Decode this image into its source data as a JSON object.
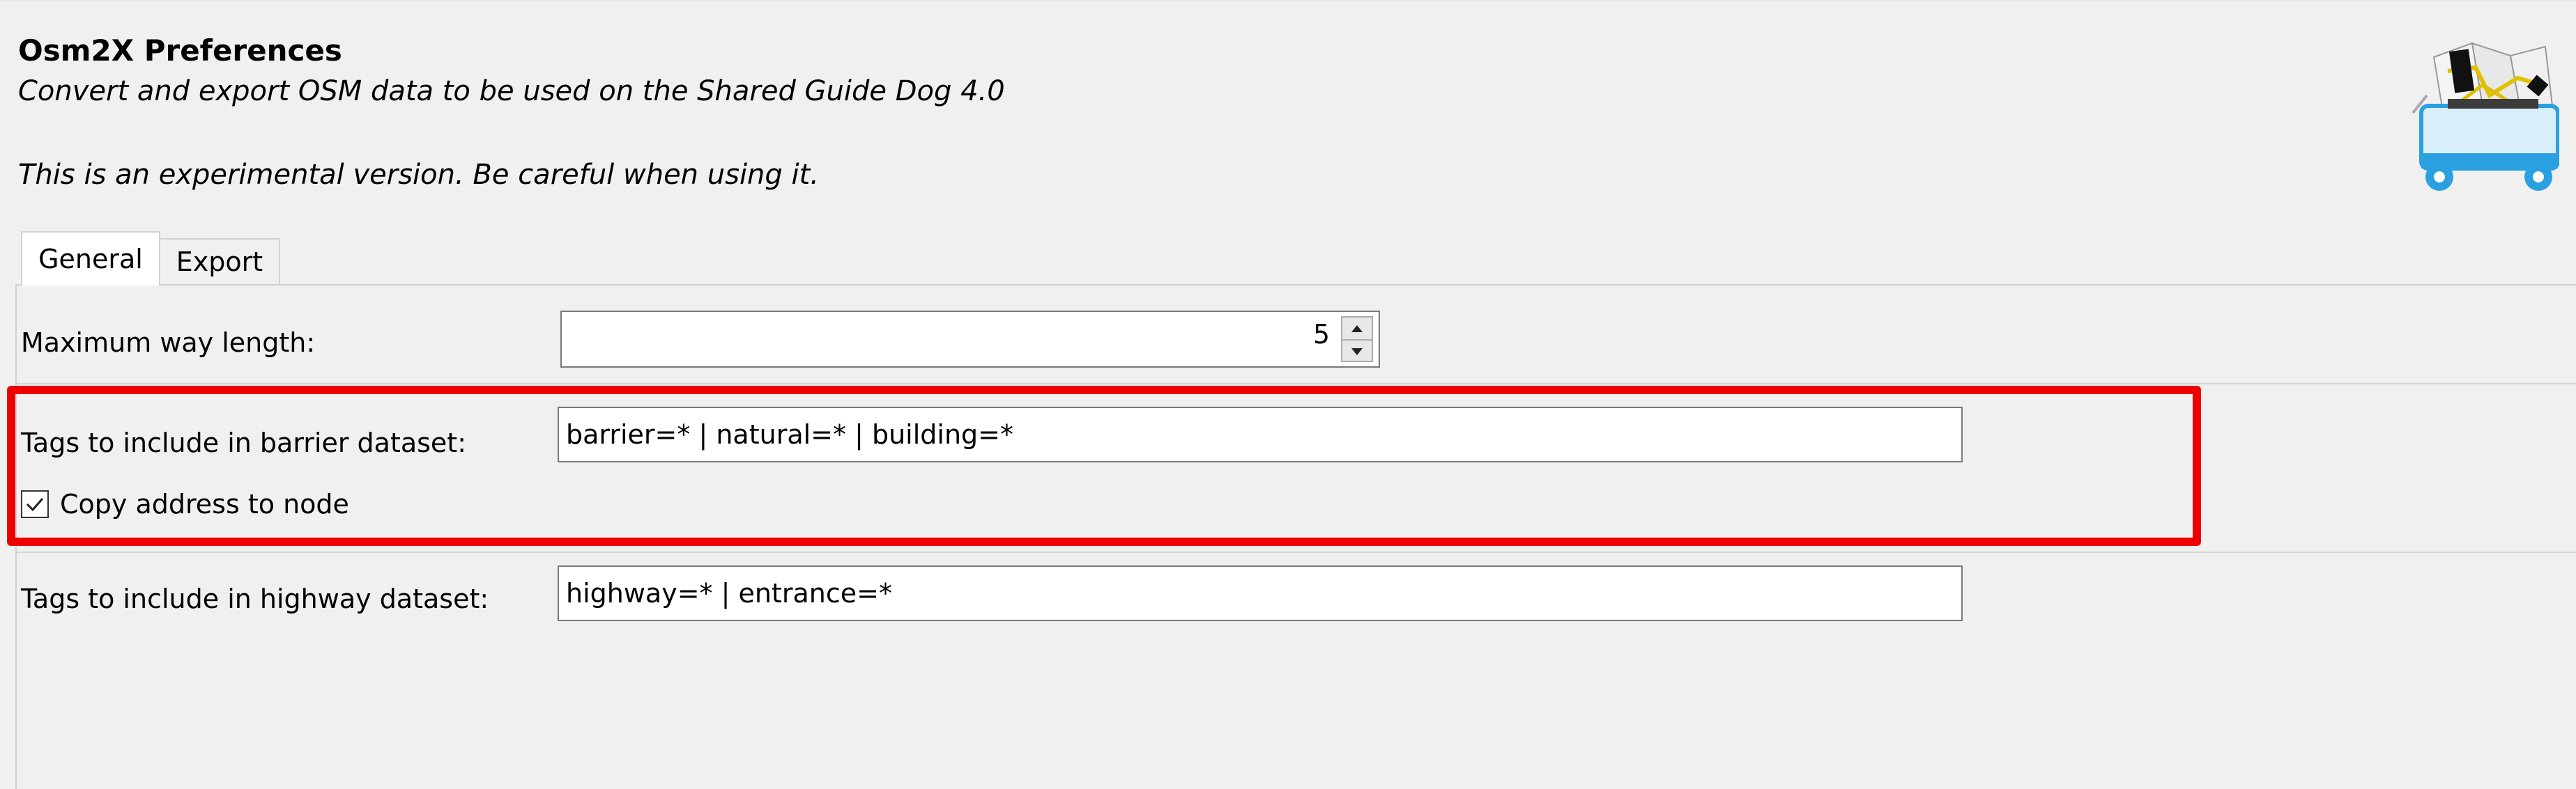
{
  "header": {
    "title": "Osm2X Preferences",
    "subtitle": "Convert and export OSM data to be used on the Shared Guide Dog 4.0",
    "note": "This is an experimental version. Be careful when using it."
  },
  "logo_icon": "cart-map-icon",
  "tabs": [
    {
      "label": "General",
      "selected": true
    },
    {
      "label": "Export",
      "selected": false
    }
  ],
  "general": {
    "max_way_length": {
      "label": "Maximum way length:",
      "value": "5"
    },
    "barrier": {
      "label": "Tags to include in barrier dataset:",
      "value": "barrier=* | natural=* | building=*"
    },
    "copy_address": {
      "label": "Copy address to node",
      "checked": true
    },
    "highway": {
      "label": "Tags to include in highway dataset:",
      "value": "highway=* | entrance=*"
    }
  },
  "colors": {
    "highlight": "#ee0000",
    "background": "#f0f0f0"
  }
}
